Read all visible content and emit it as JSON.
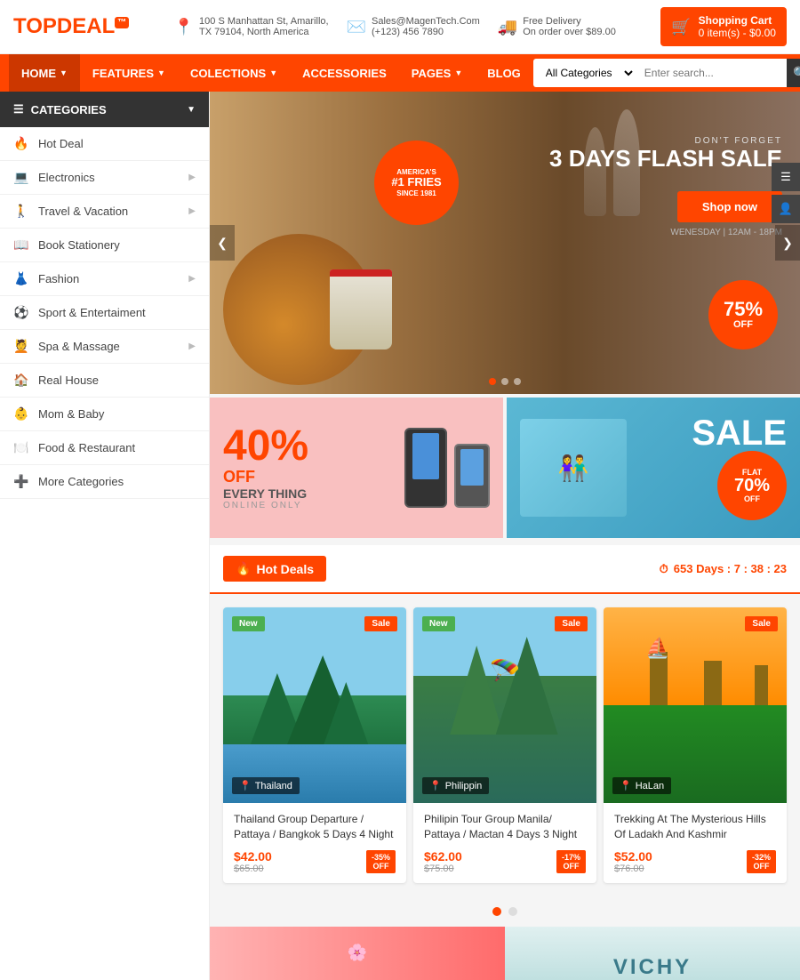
{
  "topbar": {
    "logo_top": "TOP",
    "logo_bottom": "DEAL",
    "logo_tag": "™",
    "address_icon": "📍",
    "address_line1": "100 S Manhattan St, Amarillo,",
    "address_line2": "TX 79104, North America",
    "email_icon": "✉️",
    "email": "Sales@MagenTech.Com",
    "phone": "(+123) 456 7890",
    "delivery_icon": "🚚",
    "delivery_line1": "Free Delivery",
    "delivery_line2": "On order over $89.00",
    "cart_label": "Shopping Cart",
    "cart_items": "0 item(s) - $0.00"
  },
  "nav": {
    "items": [
      {
        "label": "HOME",
        "has_arrow": true,
        "active": true
      },
      {
        "label": "FEATURES",
        "has_arrow": true
      },
      {
        "label": "COLECTIONS",
        "has_arrow": true
      },
      {
        "label": "ACCESSORIES",
        "has_arrow": false
      },
      {
        "label": "PAGES",
        "has_arrow": true
      },
      {
        "label": "BLOG",
        "has_arrow": false
      }
    ],
    "search_placeholder": "Enter search...",
    "search_category": "All Categories"
  },
  "sidebar": {
    "header": "CATEGORIES",
    "items": [
      {
        "label": "Hot Deal",
        "icon": "hot",
        "has_arrow": false
      },
      {
        "label": "Electronics",
        "icon": "elec",
        "has_arrow": true
      },
      {
        "label": "Travel & Vacation",
        "icon": "travel",
        "has_arrow": true
      },
      {
        "label": "Book Stationery",
        "icon": "book",
        "has_arrow": false
      },
      {
        "label": "Fashion",
        "icon": "fashion",
        "has_arrow": true
      },
      {
        "label": "Sport & Entertaiment",
        "icon": "sport",
        "has_arrow": false
      },
      {
        "label": "Spa & Massage",
        "icon": "spa",
        "has_arrow": true
      },
      {
        "label": "Real House",
        "icon": "house",
        "has_arrow": false
      },
      {
        "label": "Mom & Baby",
        "icon": "baby",
        "has_arrow": false
      },
      {
        "label": "Food & Restaurant",
        "icon": "food",
        "has_arrow": false
      },
      {
        "label": "More Categories",
        "icon": "more",
        "has_arrow": false
      }
    ]
  },
  "hero": {
    "dont_forget": "DON'T FORGET",
    "title_line1": "3 DAYS FLASH SALE",
    "shop_btn": "Shop now",
    "date_text": "WENESDAY | 12AM - 18PM",
    "discount_pct": "75%",
    "discount_off": "OFF",
    "badge_line1": "AMERICA'S",
    "badge_line2": "#1 FRIES",
    "badge_line3": "SINCE 1981"
  },
  "promo_left": {
    "pct": "40%",
    "off": "OFF",
    "text": "EVERY THING",
    "sub": "ONLINE ONLY"
  },
  "promo_right": {
    "sale": "SALE",
    "flat": "FLAT",
    "pct": "70%",
    "off": "OFF"
  },
  "hot_deals": {
    "title": "Hot Deals",
    "fire_icon": "🔥",
    "timer_icon": "⏱",
    "timer": "653 Days : 7 : 38 : 23"
  },
  "products": [
    {
      "badge_new": "New",
      "badge_sale": "Sale",
      "location": "Thailand",
      "title": "Thailand Group Departure / Pattaya / Bangkok 5 Days 4 Night",
      "price_new": "$42.00",
      "price_old": "$65.00",
      "discount": "-35%",
      "discount_line2": "OFF",
      "scene": "thailand"
    },
    {
      "badge_new": "New",
      "badge_sale": "Sale",
      "location": "Philippin",
      "title": "Philipin Tour Group Manila/ Pattaya / Mactan 4 Days 3 Night",
      "price_new": "$62.00",
      "price_old": "$75.00",
      "discount": "-17%",
      "discount_line2": "OFF",
      "scene": "philippin"
    },
    {
      "badge_new": "",
      "badge_sale": "Sale",
      "location": "HaLan",
      "title": "Trekking At The Mysterious Hills Of Ladakh And Kashmir",
      "price_new": "$52.00",
      "price_old": "$76.00",
      "discount": "-32%",
      "discount_line2": "OFF",
      "scene": "halan"
    }
  ],
  "bottom_banner": {
    "right_text": "VICHY"
  }
}
